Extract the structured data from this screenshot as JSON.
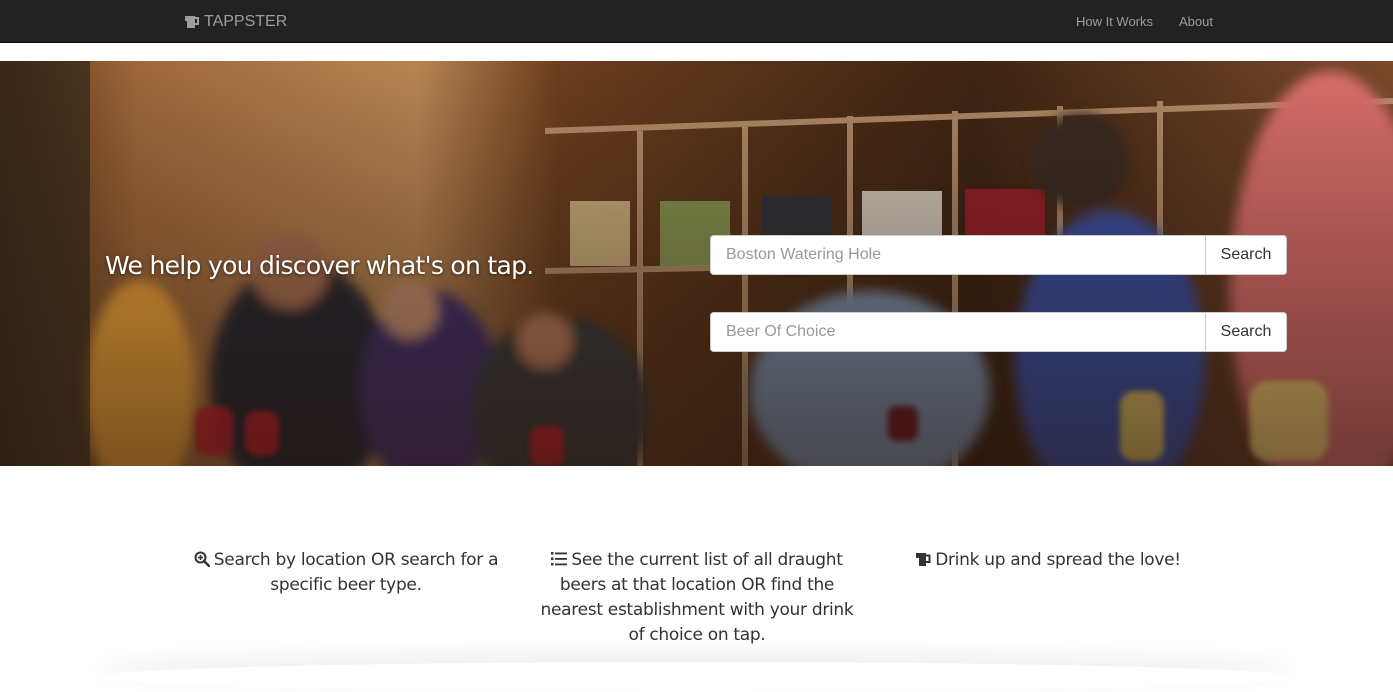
{
  "nav": {
    "brand": "TAPPSTER",
    "links": [
      {
        "label": "How It Works"
      },
      {
        "label": "About"
      }
    ]
  },
  "hero": {
    "title": "We help you discover what's on tap.",
    "search_location": {
      "placeholder": "Boston Watering Hole",
      "value": "",
      "button": "Search"
    },
    "search_beer": {
      "placeholder": "Beer Of Choice",
      "value": "",
      "button": "Search"
    }
  },
  "features": [
    {
      "icon": "search-plus-icon",
      "text": "Search by location OR search for a specific beer type."
    },
    {
      "icon": "list-icon",
      "text": "See the current list of all draught beers at that location OR find the nearest establishment with your drink of choice on tap."
    },
    {
      "icon": "beer-icon",
      "text": "Drink up and spread the love!"
    }
  ],
  "colors": {
    "navbar_bg": "#222222",
    "navbar_text": "#9d9d9d",
    "body_text": "#333333",
    "hero_text": "#ffffff"
  }
}
